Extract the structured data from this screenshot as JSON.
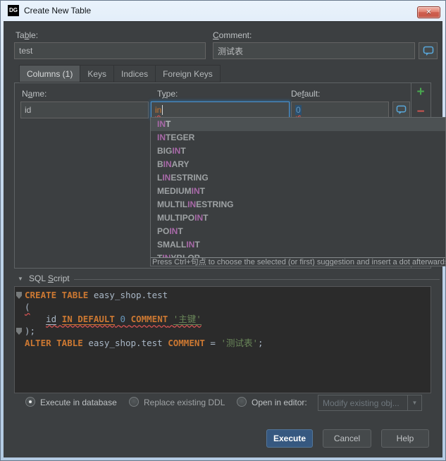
{
  "window": {
    "title": "Create New Table",
    "app_badge": "DG",
    "close_label": "x"
  },
  "form": {
    "table": {
      "label": [
        {
          "text": "Ta"
        },
        {
          "text": "b",
          "cls": "mn"
        },
        {
          "text": "le:"
        }
      ],
      "value": "test"
    },
    "comment": {
      "label": [
        {
          "text": "C",
          "cls": "mn"
        },
        {
          "text": "omment:"
        }
      ],
      "value": "测试表"
    }
  },
  "tabs": [
    {
      "label": "Columns (1)",
      "active": true
    },
    {
      "label": "Keys",
      "active": false
    },
    {
      "label": "Indices",
      "active": false
    },
    {
      "label": "Foreign Keys",
      "active": false
    }
  ],
  "columns": {
    "name": {
      "label": [
        {
          "text": "N"
        },
        {
          "text": "a",
          "cls": "mn"
        },
        {
          "text": "me:"
        }
      ],
      "value": "id"
    },
    "type": {
      "label": [
        {
          "text": "T"
        },
        {
          "text": "y",
          "cls": "mn"
        },
        {
          "text": "pe:"
        }
      ],
      "value": "in"
    },
    "default": {
      "label": [
        {
          "text": "De"
        },
        {
          "text": "f",
          "cls": "mn"
        },
        {
          "text": "ault:"
        }
      ],
      "value": "0"
    }
  },
  "completion": {
    "items": [
      {
        "selected": true,
        "segments": [
          {
            "text": "IN",
            "cls": "hl"
          },
          {
            "text": "T"
          }
        ]
      },
      {
        "selected": false,
        "segments": [
          {
            "text": "IN",
            "cls": "hl"
          },
          {
            "text": "TEGER"
          }
        ]
      },
      {
        "selected": false,
        "segments": [
          {
            "text": "BIG"
          },
          {
            "text": "IN",
            "cls": "hl"
          },
          {
            "text": "T"
          }
        ]
      },
      {
        "selected": false,
        "segments": [
          {
            "text": "B"
          },
          {
            "text": "IN",
            "cls": "hl"
          },
          {
            "text": "ARY"
          }
        ]
      },
      {
        "selected": false,
        "segments": [
          {
            "text": "L"
          },
          {
            "text": "IN",
            "cls": "hl"
          },
          {
            "text": "ESTRING"
          }
        ]
      },
      {
        "selected": false,
        "segments": [
          {
            "text": "MEDIUM"
          },
          {
            "text": "IN",
            "cls": "hl"
          },
          {
            "text": "T"
          }
        ]
      },
      {
        "selected": false,
        "segments": [
          {
            "text": "MULTIL"
          },
          {
            "text": "IN",
            "cls": "hl"
          },
          {
            "text": "ESTRING"
          }
        ]
      },
      {
        "selected": false,
        "segments": [
          {
            "text": "MULTIPO"
          },
          {
            "text": "IN",
            "cls": "hl"
          },
          {
            "text": "T"
          }
        ]
      },
      {
        "selected": false,
        "segments": [
          {
            "text": "PO"
          },
          {
            "text": "IN",
            "cls": "hl"
          },
          {
            "text": "T"
          }
        ]
      },
      {
        "selected": false,
        "segments": [
          {
            "text": "SMALL"
          },
          {
            "text": "IN",
            "cls": "hl"
          },
          {
            "text": "T"
          }
        ]
      },
      {
        "selected": false,
        "segments": [
          {
            "text": "T"
          },
          {
            "text": "IN",
            "cls": "hl"
          },
          {
            "text": "YBLOB"
          }
        ]
      }
    ],
    "hint": "Press Ctrl+句点 to choose the selected (or first) suggestion and insert a dot afterwards"
  },
  "sql": {
    "label": [
      {
        "text": "SQL "
      },
      {
        "text": "S",
        "cls": "mn"
      },
      {
        "text": "cript"
      }
    ],
    "lines": [
      [
        {
          "text": "CREATE TABLE",
          "cls": "kw"
        },
        {
          "text": " easy_shop.test",
          "cls": "plain"
        }
      ],
      [
        {
          "text": "(",
          "cls": "plain err"
        }
      ],
      [
        {
          "text": "    ",
          "cls": "plain"
        },
        {
          "text": "id",
          "cls": "plain u err"
        },
        {
          "text": " ",
          "cls": "err"
        },
        {
          "text": "IN DEFAULT",
          "cls": "kw u err"
        },
        {
          "text": " ",
          "cls": "err"
        },
        {
          "text": "0",
          "cls": "num err"
        },
        {
          "text": " ",
          "cls": "err"
        },
        {
          "text": "COMMENT",
          "cls": "kw err"
        },
        {
          "text": " ",
          "cls": "err"
        },
        {
          "text": "'主键'",
          "cls": "str u err"
        }
      ],
      [
        {
          "text": ");",
          "cls": "plain"
        }
      ],
      [
        {
          "text": "ALTER TABLE",
          "cls": "kw"
        },
        {
          "text": " easy_shop.test ",
          "cls": "plain"
        },
        {
          "text": "COMMENT",
          "cls": "kw"
        },
        {
          "text": " = ",
          "cls": "plain"
        },
        {
          "text": "'测试表'",
          "cls": "str"
        },
        {
          "text": ";",
          "cls": "plain"
        }
      ]
    ]
  },
  "options": {
    "radios": [
      {
        "label": "Execute in database",
        "selected": true
      },
      {
        "label": "Replace existing DDL",
        "selected": false
      },
      {
        "label": "Open in editor:",
        "selected": false
      }
    ],
    "open_in_editor_value": "Modify existing obj...",
    "combo_arrow": "▼"
  },
  "buttons": {
    "execute": "Execute",
    "cancel": "Cancel",
    "help": "Help"
  },
  "colors": {
    "accent_blue": "#4e94ce",
    "keyword_orange": "#cc7832",
    "string_green": "#6a8759",
    "number_blue": "#6897bb",
    "error_red": "#d25252",
    "match_purple": "#a869a8",
    "execute_button": "#365880",
    "add_green": "#49a64f",
    "remove_red": "#c75450",
    "comment_bubble_blue": "#58a7da"
  }
}
